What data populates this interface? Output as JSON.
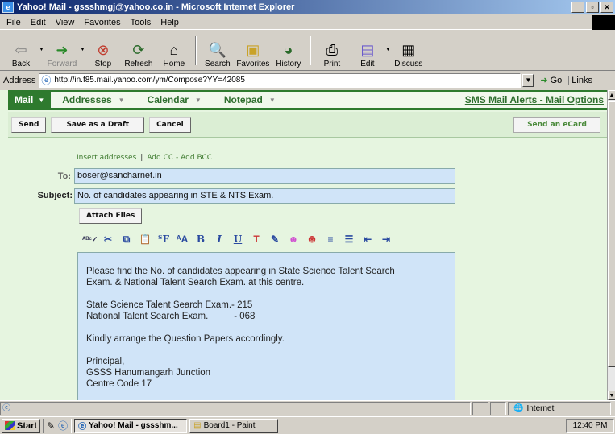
{
  "window": {
    "title": "Yahoo! Mail - gssshmgj@yahoo.co.in - Microsoft Internet Explorer",
    "controls": [
      "_",
      "▫",
      "✕"
    ]
  },
  "menu": [
    "File",
    "Edit",
    "View",
    "Favorites",
    "Tools",
    "Help"
  ],
  "toolbar": {
    "back": "Back",
    "forward": "Forward",
    "stop": "Stop",
    "refresh": "Refresh",
    "home": "Home",
    "search": "Search",
    "favorites": "Favorites",
    "history": "History",
    "print": "Print",
    "edit": "Edit",
    "discuss": "Discuss"
  },
  "address": {
    "label": "Address",
    "url": "http://in.f85.mail.yahoo.com/ym/Compose?YY=42085",
    "go": "Go",
    "links": "Links"
  },
  "ymail": {
    "nav": {
      "mail": "Mail",
      "addresses": "Addresses",
      "calendar": "Calendar",
      "notepad": "Notepad",
      "sms_alerts": "SMS Mail Alerts",
      "separator": " - ",
      "mail_options": "Mail Options"
    },
    "actions": {
      "send": "Send",
      "save_draft": "Save as a Draft",
      "cancel": "Cancel",
      "ecard": "Send an eCard"
    },
    "compose": {
      "insert_addresses": "Insert addresses",
      "bar": "|",
      "add_cc": "Add CC",
      "dash": " - ",
      "add_bcc": "Add BCC",
      "to_label": "To:",
      "to_value": "boser@sancharnet.in",
      "subject_label": "Subject:",
      "subject_value": "No. of candidates appearing in STE & NTS Exam.",
      "attach_files": "Attach Files",
      "body_lines": [
        "Please find the No. of candidates appearing in State Science Talent Search",
        "Exam. & National Talent Search Exam. at this centre.",
        "",
        "State Science Talent Search Exam.- 215",
        "National Talent Search Exam.          - 068",
        "",
        "Kindly arrange the Question Papers accordingly.",
        "",
        "Principal,",
        "GSSS Hanumangarh Junction",
        "Centre Code 17"
      ]
    }
  },
  "status": {
    "zone": "Internet"
  },
  "taskbar": {
    "start": "Start",
    "items": [
      "Yahoo! Mail - gssshm...",
      "Board1 - Paint"
    ],
    "clock": "12:40 PM"
  }
}
